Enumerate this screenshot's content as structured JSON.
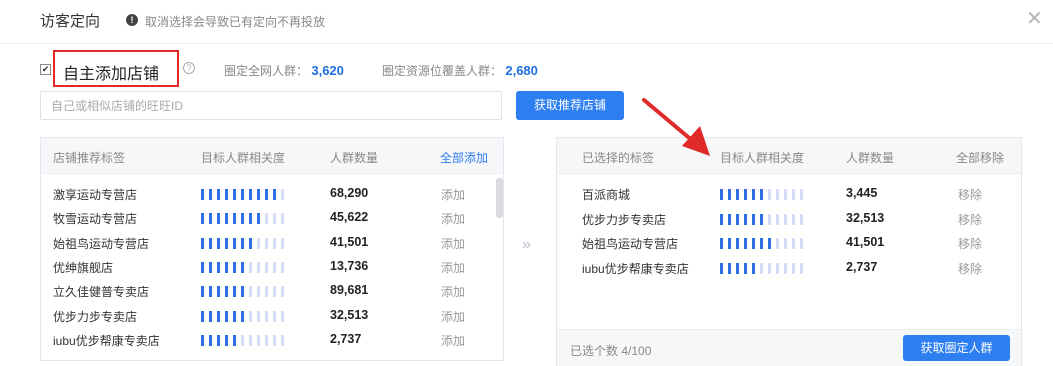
{
  "header": {
    "title": "访客定向",
    "info_glyph": "!",
    "notice": "取消选择会导致已有定向不再投放",
    "close_glyph": "✕"
  },
  "self_add": {
    "checked": true,
    "label": "自主添加店铺",
    "help_glyph": "?",
    "stat1_label": "圈定全网人群：",
    "stat1_value": "3,620",
    "stat2_label": "圈定资源位覆盖人群：",
    "stat2_value": "2,680"
  },
  "search": {
    "placeholder": "自己或相似店铺的旺旺ID",
    "button_label": "获取推荐店铺"
  },
  "left_panel": {
    "columns": [
      "店铺推荐标签",
      "目标人群相关度",
      "人群数量"
    ],
    "action_all": "全部添加",
    "rows": [
      {
        "name": "激享运动专营店",
        "relevance": 10,
        "count": "68,290",
        "action": "添加"
      },
      {
        "name": "牧雪运动专营店",
        "relevance": 8,
        "count": "45,622",
        "action": "添加"
      },
      {
        "name": "始祖鸟运动专营店",
        "relevance": 7,
        "count": "41,501",
        "action": "添加"
      },
      {
        "name": "优绅旗舰店",
        "relevance": 6,
        "count": "13,736",
        "action": "添加"
      },
      {
        "name": "立久佳健普专卖店",
        "relevance": 6,
        "count": "89,681",
        "action": "添加"
      },
      {
        "name": "优步力步专卖店",
        "relevance": 6,
        "count": "32,513",
        "action": "添加"
      },
      {
        "name": "iubu优步帮康专卖店",
        "relevance": 5,
        "count": "2,737",
        "action": "添加"
      }
    ]
  },
  "transfer_glyph": "»",
  "right_panel": {
    "columns": [
      "已选择的标签",
      "目标人群相关度",
      "人群数量"
    ],
    "action_all": "全部移除",
    "rows": [
      {
        "name": "百派商城",
        "relevance": 6,
        "count": "3,445",
        "action": "移除"
      },
      {
        "name": "优步力步专卖店",
        "relevance": 6,
        "count": "32,513",
        "action": "移除"
      },
      {
        "name": "始祖鸟运动专营店",
        "relevance": 7,
        "count": "41,501",
        "action": "移除"
      },
      {
        "name": "iubu优步帮康专卖店",
        "relevance": 5,
        "count": "2,737",
        "action": "移除"
      }
    ],
    "selected_count": "已选个数 4/100",
    "button_label": "获取圈定人群"
  },
  "bar_segments_total": 11,
  "colors": {
    "accent": "#2d7ef0",
    "bar_on": "#2d6fe0",
    "bar_off": "#d4dff3",
    "highlight": "#e02a2a"
  }
}
